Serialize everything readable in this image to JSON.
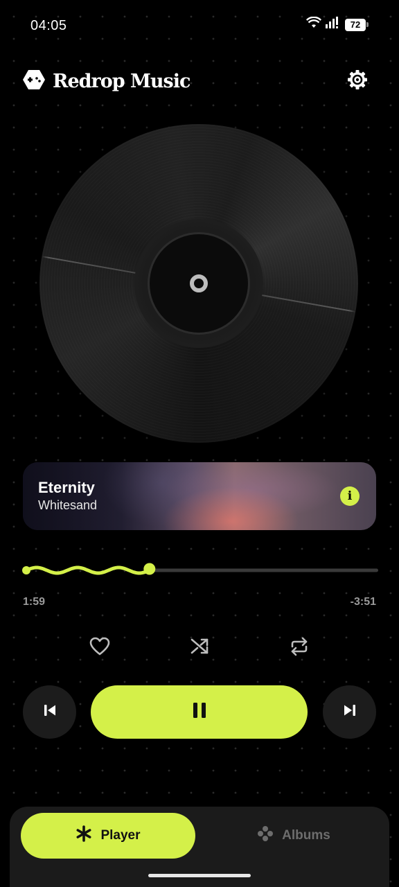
{
  "status_bar": {
    "time": "04:05",
    "battery": "72"
  },
  "header": {
    "app_title": "Redrop Music",
    "logo_icon": "gamepad-hexagon-icon",
    "settings_icon": "gear-icon"
  },
  "now_playing": {
    "title": "Eternity",
    "artist": "Whitesand",
    "info_label": "i",
    "elapsed": "1:59",
    "remaining": "-3:51",
    "progress": 0.35
  },
  "controls": {
    "favorite_icon": "heart-icon",
    "shuffle_icon": "shuffle-icon",
    "repeat_icon": "repeat-icon",
    "previous_icon": "skip-previous-icon",
    "pause_icon": "pause-icon",
    "next_icon": "skip-next-icon"
  },
  "nav": {
    "tabs": [
      {
        "label": "Player",
        "icon": "asterisk-icon",
        "active": true
      },
      {
        "label": "Albums",
        "icon": "dots-cluster-icon",
        "active": false
      }
    ]
  },
  "colors": {
    "accent": "#d4f049",
    "background": "#000000",
    "surface": "#1b1b1b",
    "muted_text": "#9a9a9a"
  }
}
